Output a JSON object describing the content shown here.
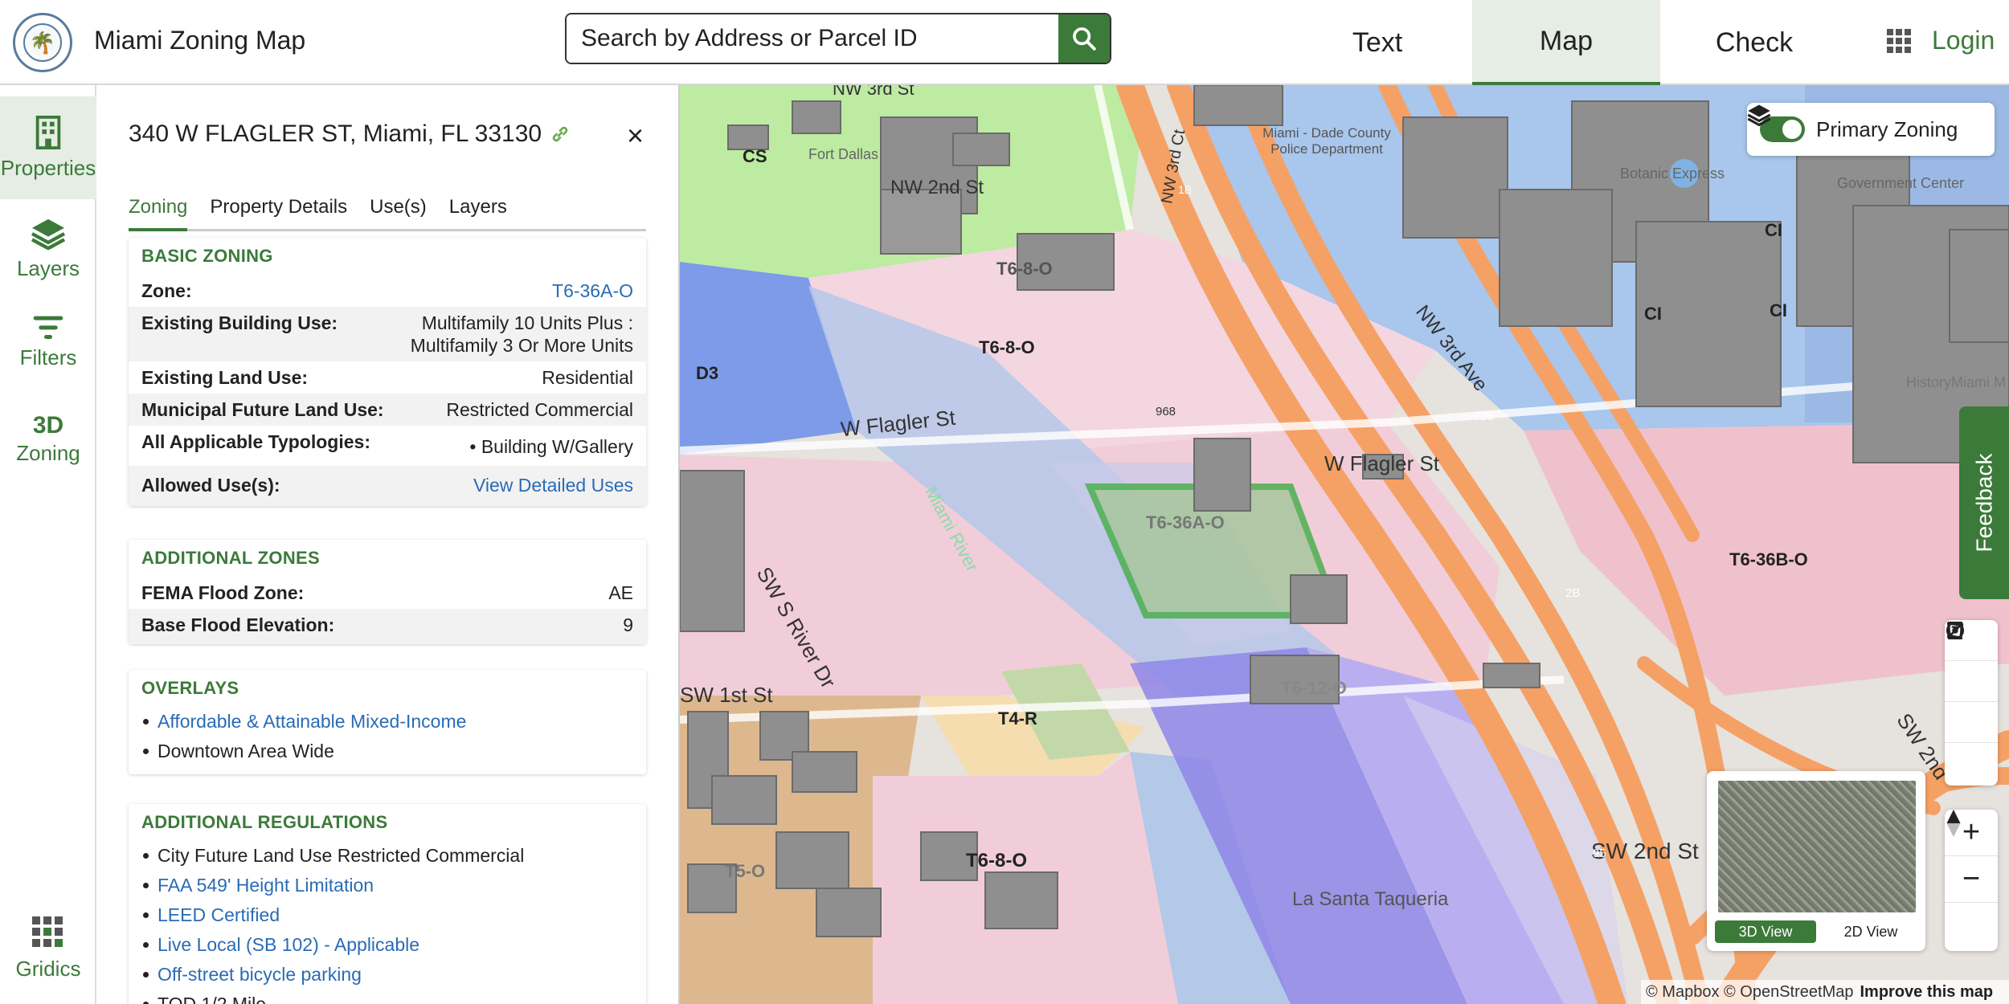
{
  "header": {
    "app_title": "Miami Zoning Map",
    "search_placeholder": "Search by Address or Parcel ID",
    "tabs": [
      {
        "label": "Text"
      },
      {
        "label": "Map"
      },
      {
        "label": "Check"
      }
    ],
    "login_label": "Login"
  },
  "rail": {
    "items": [
      {
        "label": "Properties"
      },
      {
        "label": "Layers"
      },
      {
        "label": "Filters"
      },
      {
        "label": "Zoning",
        "icon_text": "3D"
      },
      {
        "label": "Gridics"
      }
    ]
  },
  "panel": {
    "address": "340 W FLAGLER ST, Miami, FL 33130",
    "close": "×",
    "tabs": [
      {
        "label": "Zoning"
      },
      {
        "label": "Property Details"
      },
      {
        "label": "Use(s)"
      },
      {
        "label": "Layers"
      }
    ],
    "basic": {
      "heading": "BASIC ZONING",
      "rows": [
        {
          "k": "Zone:",
          "v": "T6-36A-O"
        },
        {
          "k": "Existing Building Use:",
          "v": "Multifamily 10 Units Plus : Multifamily 3 Or More Units"
        },
        {
          "k": "Existing Land Use:",
          "v": "Residential"
        },
        {
          "k": "Municipal Future Land Use:",
          "v": "Restricted Commercial"
        },
        {
          "k": "All Applicable Typologies:",
          "v": "Building W/Gallery"
        },
        {
          "k": "Allowed Use(s):",
          "v": "View Detailed Uses"
        }
      ]
    },
    "additional_zones": {
      "heading": "ADDITIONAL ZONES",
      "rows": [
        {
          "k": "FEMA Flood Zone:",
          "v": "AE"
        },
        {
          "k": "Base Flood Elevation:",
          "v": "9"
        }
      ]
    },
    "overlays": {
      "heading": "OVERLAYS",
      "items": [
        "Affordable & Attainable Mixed-Income",
        "Downtown Area Wide"
      ]
    },
    "regulations": {
      "heading": "ADDITIONAL REGULATIONS",
      "items": [
        "City Future Land Use Restricted Commercial",
        "FAA 549' Height Limitation",
        "LEED Certified",
        "Live Local (SB 102) - Applicable",
        "Off-street bicycle parking",
        "TOD 1/2 Mile"
      ]
    }
  },
  "map": {
    "toggle_label": "Primary Zoning",
    "feedback_label": "Feedback",
    "view_3d": "3D View",
    "view_2d": "2D View",
    "attribution": "© Mapbox © OpenStreetMap",
    "improve": "Improve this map",
    "labels": {
      "cs": "CS",
      "ci1": "CI",
      "ci2": "CI",
      "ci3": "CI",
      "d3": "D3",
      "t68o_a": "T6-8-O",
      "t68o_b": "T6-8-O",
      "t68o_c": "T6-8-O",
      "t636ao": "T6-36A-O",
      "t636bo": "T6-36B-O",
      "t612o": "T6-12-O",
      "t4r": "T4-R",
      "t5o": "T5-O",
      "nw3rd": "NW 3rd St",
      "nw2nd": "NW 2nd St",
      "nw3rdct": "NW 3rd Ct",
      "nw3rdave": "NW 3rd Ave",
      "wflagler1": "W Flagler St",
      "wflagler2": "W Flagler St",
      "sw1st": "SW 1st St",
      "swsriver": "SW S River Dr",
      "sw2ndst": "SW 2nd St",
      "sw2nd": "SW 2nd",
      "miamiriver": "Miami River",
      "police": "Miami - Dade County Police Department",
      "fortdallas": "Fort Dallas",
      "botanical": "Botanic Express",
      "govcenter": "Government Center",
      "taqueria": "La Santa Taqueria",
      "history": "HistoryMiami M",
      "n968": "968",
      "n925": "925",
      "n95": "95",
      "n2b": "2B",
      "n1b": "1B"
    }
  }
}
